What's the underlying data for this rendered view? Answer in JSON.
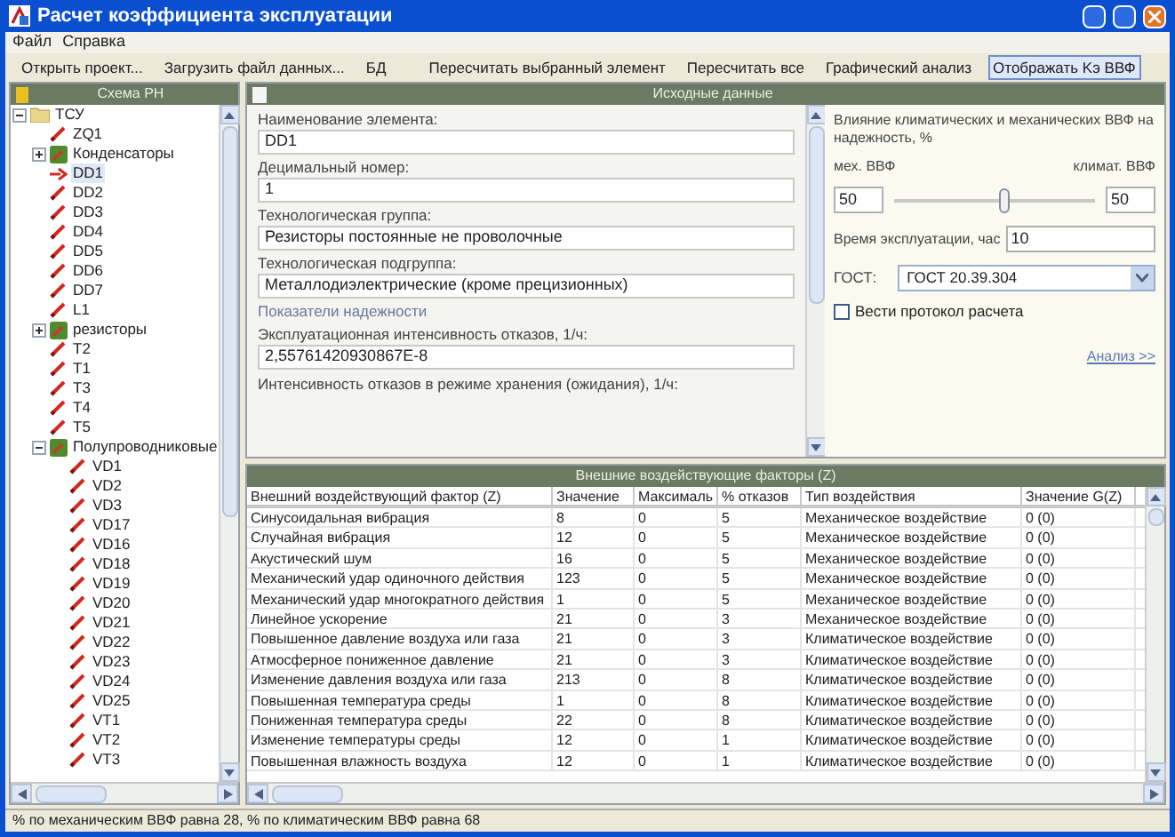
{
  "window": {
    "title": "Расчет коэффициента эксплуатации"
  },
  "menu": [
    "Файл",
    "Справка"
  ],
  "toolbar": [
    {
      "label": "Открыть проект...",
      "selected": false
    },
    {
      "label": "Загрузить файл данных...",
      "selected": false
    },
    {
      "label": "БД",
      "selected": false
    },
    {
      "label": "Пересчитать выбранный элемент",
      "selected": false
    },
    {
      "label": "Пересчитать все",
      "selected": false
    },
    {
      "label": "Графический анализ",
      "selected": false
    },
    {
      "label": "Отображать Kэ ВВФ",
      "selected": true
    }
  ],
  "tree": {
    "title": "Схема РН",
    "items": [
      {
        "label": "ТСУ",
        "kind": "folder",
        "expanded": true,
        "selected": false,
        "children": [
          {
            "label": "ZQ1",
            "kind": "leaf",
            "selected": false
          },
          {
            "label": "Конденсаторы",
            "kind": "group",
            "expanded": false,
            "selected": false
          },
          {
            "label": "DD1",
            "kind": "leaf",
            "selected": true
          },
          {
            "label": "DD2",
            "kind": "leaf",
            "selected": false
          },
          {
            "label": "DD3",
            "kind": "leaf",
            "selected": false
          },
          {
            "label": "DD4",
            "kind": "leaf",
            "selected": false
          },
          {
            "label": "DD5",
            "kind": "leaf",
            "selected": false
          },
          {
            "label": "DD6",
            "kind": "leaf",
            "selected": false
          },
          {
            "label": "DD7",
            "kind": "leaf",
            "selected": false
          },
          {
            "label": "L1",
            "kind": "leaf",
            "selected": false
          },
          {
            "label": "резисторы",
            "kind": "group",
            "expanded": false,
            "selected": false
          },
          {
            "label": "T2",
            "kind": "leaf",
            "selected": false
          },
          {
            "label": "T1",
            "kind": "leaf",
            "selected": false
          },
          {
            "label": "T3",
            "kind": "leaf",
            "selected": false
          },
          {
            "label": "T4",
            "kind": "leaf",
            "selected": false
          },
          {
            "label": "T5",
            "kind": "leaf",
            "selected": false
          },
          {
            "label": "Полупроводниковые",
            "kind": "group",
            "expanded": true,
            "selected": false,
            "children": [
              {
                "label": "VD1",
                "kind": "leaf",
                "selected": false
              },
              {
                "label": "VD2",
                "kind": "leaf",
                "selected": false
              },
              {
                "label": "VD3",
                "kind": "leaf",
                "selected": false
              },
              {
                "label": "VD17",
                "kind": "leaf",
                "selected": false
              },
              {
                "label": "VD16",
                "kind": "leaf",
                "selected": false
              },
              {
                "label": "VD18",
                "kind": "leaf",
                "selected": false
              },
              {
                "label": "VD19",
                "kind": "leaf",
                "selected": false
              },
              {
                "label": "VD20",
                "kind": "leaf",
                "selected": false
              },
              {
                "label": "VD21",
                "kind": "leaf",
                "selected": false
              },
              {
                "label": "VD22",
                "kind": "leaf",
                "selected": false
              },
              {
                "label": "VD23",
                "kind": "leaf",
                "selected": false
              },
              {
                "label": "VD24",
                "kind": "leaf",
                "selected": false
              },
              {
                "label": "VD25",
                "kind": "leaf",
                "selected": false
              },
              {
                "label": "VT1",
                "kind": "leaf",
                "selected": false
              },
              {
                "label": "VT2",
                "kind": "leaf",
                "selected": false
              },
              {
                "label": "VT3",
                "kind": "leaf",
                "selected": false
              }
            ]
          }
        ]
      }
    ]
  },
  "source": {
    "title": "Исходные данные",
    "form": [
      {
        "kind": "field",
        "label": "Наименование элемента:",
        "value": "DD1"
      },
      {
        "kind": "field",
        "label": "Децимальный номер:",
        "value": "1"
      },
      {
        "kind": "field",
        "label": "Технологическая группа:",
        "value": "Резисторы постоянные не проволочные"
      },
      {
        "kind": "field",
        "label": "Технологическая подгруппа:",
        "value": "Металлодиэлектрические (кроме прецизионных)"
      },
      {
        "kind": "heading",
        "label": "Показатели надежности"
      },
      {
        "kind": "field",
        "label": "Эксплуатационная интенсивность отказов, 1/ч:",
        "value": "2,55761420930867E-8"
      },
      {
        "kind": "label",
        "label": "Интенсивность отказов в режиме хранения (ожидания), 1/ч:"
      }
    ],
    "influence": {
      "title": "Влияние климатических и механических ВВФ на надежность, %",
      "left_label": "мех. ВВФ",
      "right_label": "климат. ВВФ",
      "left_value": "50",
      "right_value": "50",
      "level": 0.55
    },
    "time": {
      "label": "Время эксплуатации, час",
      "value": "10"
    },
    "gost": {
      "label": "ГОСТ:",
      "value": "ГОСТ 20.39.304"
    },
    "protocol": {
      "label": "Вести протокол расчета",
      "checked": false
    },
    "analysis_link": "Анализ >>"
  },
  "factors": {
    "title": "Внешние воздействующие факторы (Z)",
    "columns": [
      "Внешний воздействующий фактор (Z)",
      "Значение",
      "Максималь",
      "% отказов",
      "Тип воздействия",
      "Значение G(Z)"
    ],
    "rows": [
      [
        "Синусоидальная вибрация",
        "8",
        "0",
        "5",
        "Механическое воздействие",
        "0 (0)"
      ],
      [
        "Случайная вибрация",
        "12",
        "0",
        "5",
        "Механическое воздействие",
        "0 (0)"
      ],
      [
        "Акустический шум",
        "16",
        "0",
        "5",
        "Механическое воздействие",
        "0 (0)"
      ],
      [
        "Механический удар одиночного действия",
        "123",
        "0",
        "5",
        "Механическое воздействие",
        "0 (0)"
      ],
      [
        "Механический удар многократного действия",
        "1",
        "0",
        "5",
        "Механическое воздействие",
        "0 (0)"
      ],
      [
        "Линейное ускорение",
        "21",
        "0",
        "3",
        "Механическое воздействие",
        "0 (0)"
      ],
      [
        "Повышенное давление воздуха или газа",
        "21",
        "0",
        "3",
        "Климатическое воздействие",
        "0 (0)"
      ],
      [
        "Атмосферное пониженное давление",
        "21",
        "0",
        "3",
        "Климатическое воздействие",
        "0 (0)"
      ],
      [
        "Изменение давления воздуха или газа",
        "213",
        "0",
        "8",
        "Климатическое воздействие",
        "0 (0)"
      ],
      [
        "Повышенная температура среды",
        "1",
        "0",
        "8",
        "Климатическое воздействие",
        "0 (0)"
      ],
      [
        "Пониженная температура среды",
        "22",
        "0",
        "8",
        "Климатическое воздействие",
        "0 (0)"
      ],
      [
        "Изменение температуры среды",
        "12",
        "0",
        "1",
        "Климатическое воздействие",
        "0 (0)"
      ],
      [
        "Повышенная влажность воздуха",
        "12",
        "0",
        "1",
        "Климатическое воздействие",
        "0 (0)"
      ]
    ]
  },
  "status_bar": "% по механическим ВВФ равна 28, % по климатическим ВВФ равна 68"
}
